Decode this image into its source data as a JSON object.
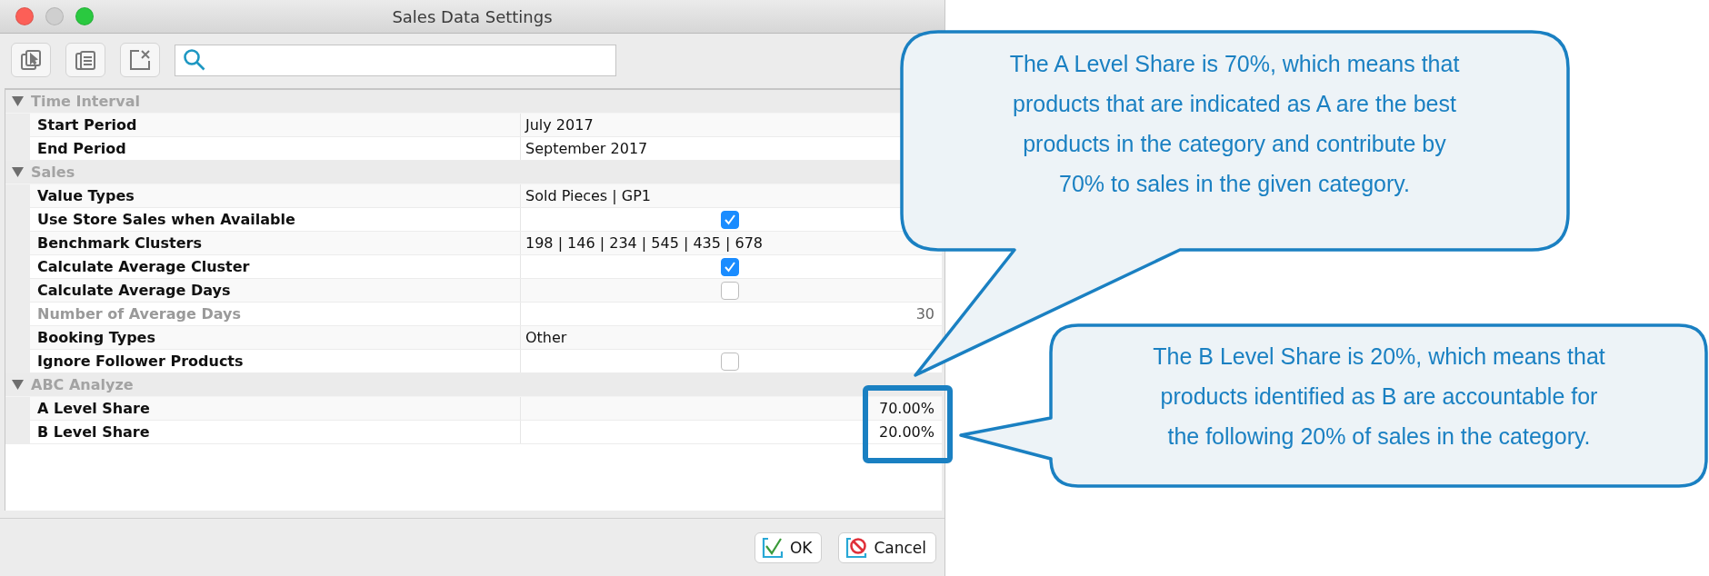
{
  "window": {
    "title": "Sales Data Settings"
  },
  "toolbar": {
    "buttons": [
      {
        "kind": "copy"
      },
      {
        "kind": "paste"
      },
      {
        "kind": "clear"
      }
    ]
  },
  "sections": [
    {
      "title": "Time Interval",
      "expanded": true,
      "rows": [
        {
          "label": "Start Period",
          "kind": "text",
          "value": "July 2017",
          "disabled": false
        },
        {
          "label": "End Period",
          "kind": "text",
          "value": "September 2017",
          "disabled": false
        }
      ]
    },
    {
      "title": "Sales",
      "expanded": true,
      "rows": [
        {
          "label": "Value Types",
          "kind": "text",
          "value": "Sold Pieces | GP1",
          "disabled": false
        },
        {
          "label": "Use Store Sales when Available",
          "kind": "checkbox",
          "checked": true,
          "disabled": false
        },
        {
          "label": "Benchmark Clusters",
          "kind": "text",
          "value": "198 | 146 | 234 | 545 | 435 | 678",
          "disabled": false
        },
        {
          "label": "Calculate Average Cluster",
          "kind": "checkbox",
          "checked": true,
          "disabled": false
        },
        {
          "label": "Calculate Average Days",
          "kind": "checkbox",
          "checked": false,
          "disabled": false
        },
        {
          "label": "Number of Average Days",
          "kind": "number",
          "value": "30",
          "disabled": true
        },
        {
          "label": "Booking Types",
          "kind": "text",
          "value": "Other",
          "disabled": false
        },
        {
          "label": "Ignore Follower Products",
          "kind": "checkbox",
          "checked": false,
          "disabled": false
        }
      ]
    },
    {
      "title": "ABC Analyze",
      "expanded": true,
      "rows": [
        {
          "label": "A Level Share",
          "kind": "number",
          "value": "70.00%",
          "disabled": false
        },
        {
          "label": "B Level Share",
          "kind": "number",
          "value": "20.00%",
          "disabled": false
        }
      ]
    }
  ],
  "buttons": [
    {
      "kind": "ok",
      "label": "OK"
    },
    {
      "kind": "cancel",
      "label": "Cancel"
    }
  ],
  "callouts": [
    {
      "lines": [
        "The A Level Share is 70%, which means that",
        "products that are indicated as A are the best",
        "products in the category and contribute by",
        "70% to sales in the given category."
      ]
    },
    {
      "lines": [
        "The B Level Share is 20%, which means that",
        "products identified as B are accountable for",
        "the following 20% of sales in the category."
      ]
    }
  ]
}
